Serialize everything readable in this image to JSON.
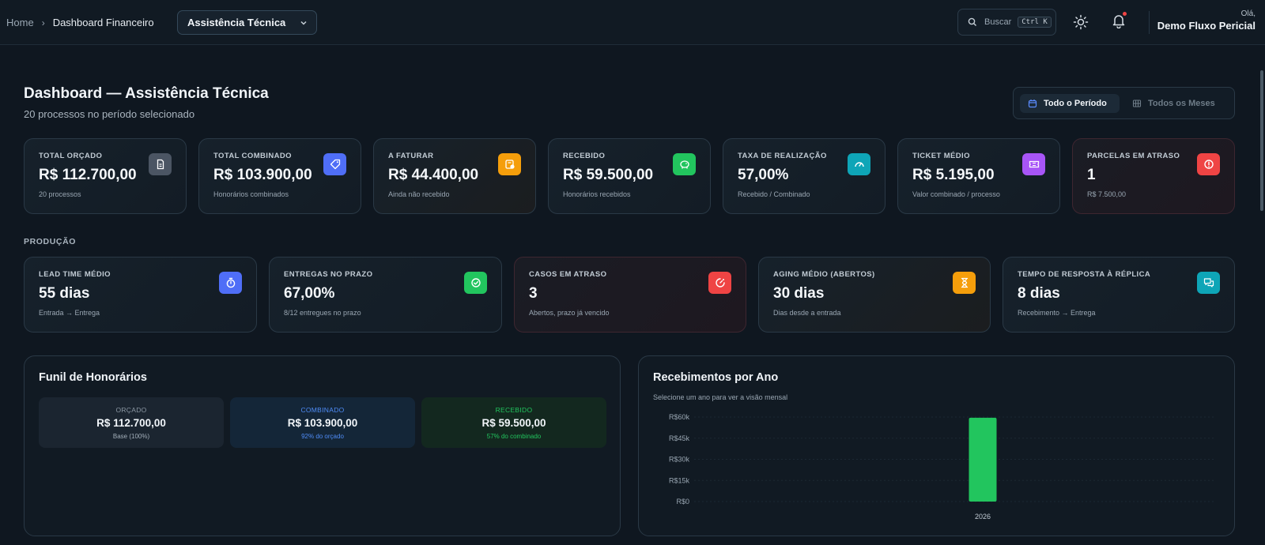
{
  "breadcrumb": {
    "home": "Home",
    "current": "Dashboard Financeiro"
  },
  "selector": {
    "value": "Assistência Técnica"
  },
  "search": {
    "placeholder": "Buscar",
    "shortcut": "Ctrl K"
  },
  "user": {
    "greeting": "Olá,",
    "name": "Demo Fluxo Pericial"
  },
  "header": {
    "title": "Dashboard — Assistência Técnica",
    "subtitle": "20 processos no período selecionado"
  },
  "period": {
    "active": "Todo o Período",
    "inactive": "Todos os Meses"
  },
  "kpis": [
    {
      "label": "TOTAL ORÇADO",
      "value": "R$ 112.700,00",
      "sub": "20 processos",
      "icon": "document-icon",
      "color": "#4b5563"
    },
    {
      "label": "TOTAL COMBINADO",
      "value": "R$ 103.900,00",
      "sub": "Honorários combinados",
      "icon": "tag-icon",
      "color": "#4f6ef7"
    },
    {
      "label": "A FATURAR",
      "value": "R$ 44.400,00",
      "sub": "Ainda não recebido",
      "icon": "invoice-icon",
      "color": "#f59e0b"
    },
    {
      "label": "RECEBIDO",
      "value": "R$ 59.500,00",
      "sub": "Honorários recebidos",
      "icon": "piggy-bank-icon",
      "color": "#22c55e"
    },
    {
      "label": "TAXA DE REALIZAÇÃO",
      "value": "57,00%",
      "sub": "Recebido / Combinado",
      "icon": "gauge-icon",
      "color": "#0ea5b7"
    },
    {
      "label": "TICKET MÉDIO",
      "value": "R$ 5.195,00",
      "sub": "Valor combinado / processo",
      "icon": "ticket-icon",
      "color": "#a855f7"
    },
    {
      "label": "PARCELAS EM ATRASO",
      "value": "1",
      "sub": "R$ 7.500,00",
      "icon": "alert-icon",
      "color": "#ef4444"
    }
  ],
  "production": {
    "section_label": "PRODUÇÃO",
    "cards": [
      {
        "label": "LEAD TIME MÉDIO",
        "value": "55 dias",
        "sub": "Entrada → Entrega",
        "icon": "stopwatch-icon",
        "color": "#4f6ef7"
      },
      {
        "label": "ENTREGAS NO PRAZO",
        "value": "67,00%",
        "sub": "8/12 entregues no prazo",
        "icon": "check-circle-icon",
        "color": "#22c55e"
      },
      {
        "label": "CASOS EM ATRASO",
        "value": "3",
        "sub": "Abertos, prazo já vencido",
        "icon": "timer-alert-icon",
        "color": "#ef4444"
      },
      {
        "label": "AGING MÉDIO (ABERTOS)",
        "value": "30 dias",
        "sub": "Dias desde a entrada",
        "icon": "hourglass-icon",
        "color": "#f59e0b"
      },
      {
        "label": "TEMPO DE RESPOSTA À RÉPLICA",
        "value": "8 dias",
        "sub": "Recebimento → Entrega",
        "icon": "chat-icon",
        "color": "#0ea5b7"
      }
    ]
  },
  "funnel": {
    "title": "Funil de Honorários",
    "stages": [
      {
        "label": "ORÇADO",
        "value": "R$ 112.700,00",
        "sub": "Base (100%)"
      },
      {
        "label": "COMBINADO",
        "value": "R$ 103.900,00",
        "sub": "92% do orçado"
      },
      {
        "label": "RECEBIDO",
        "value": "R$ 59.500,00",
        "sub": "57% do combinado"
      }
    ]
  },
  "receipts": {
    "title": "Recebimentos por Ano",
    "subtitle": "Selecione um ano para ver a visão mensal"
  },
  "chart_data": {
    "type": "bar",
    "title": "Recebimentos por Ano",
    "categories": [
      "2026"
    ],
    "values": [
      59500
    ],
    "ylim": [
      0,
      60000
    ],
    "yticks": [
      0,
      15000,
      30000,
      45000,
      60000
    ],
    "ytick_labels": [
      "R$0",
      "R$15k",
      "R$30k",
      "R$45k",
      "R$60k"
    ],
    "bar_color": "#22c55e",
    "grid": true
  }
}
